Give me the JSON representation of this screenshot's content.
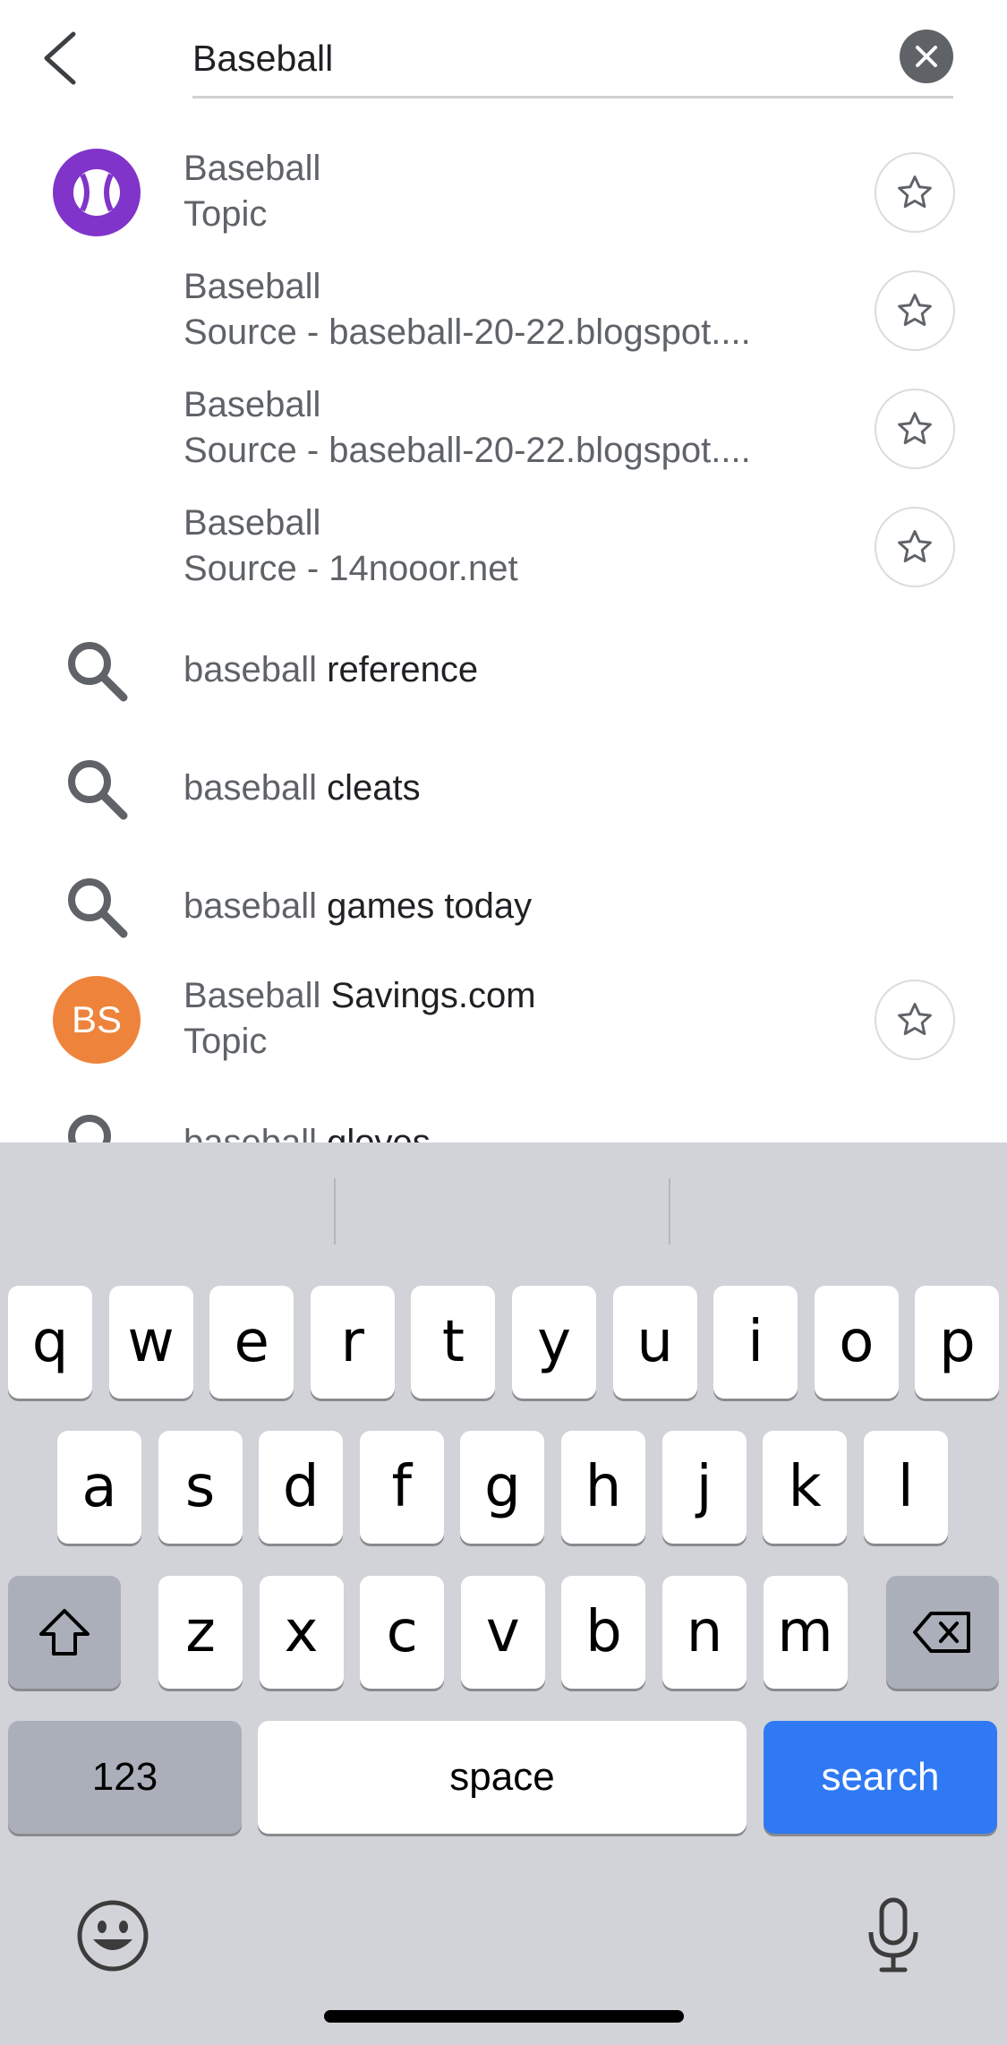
{
  "search": {
    "query": "Baseball"
  },
  "results": [
    {
      "type": "topic",
      "line1_normal": "Baseball",
      "line1_strong": "",
      "line2": "Topic",
      "avatar_color": "#8134c9",
      "avatar_icon": "baseball-icon"
    },
    {
      "type": "source",
      "line1_normal": "Baseball",
      "line1_strong": "",
      "line2": "Source - baseball-20-22.blogspot...."
    },
    {
      "type": "source",
      "line1_normal": "Baseball",
      "line1_strong": "",
      "line2": "Source - baseball-20-22.blogspot...."
    },
    {
      "type": "source",
      "line1_normal": "Baseball",
      "line1_strong": "",
      "line2": "Source - 14nooor.net"
    },
    {
      "type": "query",
      "line1_normal": "baseball",
      "line1_strong": "reference"
    },
    {
      "type": "query",
      "line1_normal": "baseball",
      "line1_strong": "cleats"
    },
    {
      "type": "query",
      "line1_normal": "baseball",
      "line1_strong": "games today"
    },
    {
      "type": "topic",
      "line1_normal": "Baseball",
      "line1_strong": "Savings.com",
      "line2": "Topic",
      "avatar_color": "#ee843c",
      "avatar_text": "BS"
    },
    {
      "type": "query",
      "line1_normal": "baseball",
      "line1_strong": "gloves"
    }
  ],
  "keyboard": {
    "row1": [
      "q",
      "w",
      "e",
      "r",
      "t",
      "y",
      "u",
      "i",
      "o",
      "p"
    ],
    "row2": [
      "a",
      "s",
      "d",
      "f",
      "g",
      "h",
      "j",
      "k",
      "l"
    ],
    "row3": [
      "z",
      "x",
      "c",
      "v",
      "b",
      "n",
      "m"
    ],
    "numbers_label": "123",
    "space_label": "space",
    "search_label": "search",
    "search_color": "#2f7af4"
  }
}
